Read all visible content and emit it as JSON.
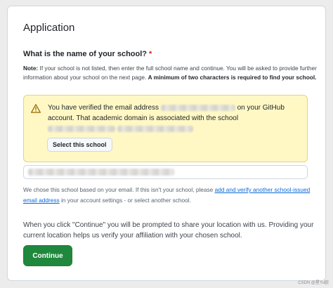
{
  "page": {
    "title": "Application"
  },
  "question": {
    "label": "What is the name of your school?",
    "required_marker": "*"
  },
  "note": {
    "prefix": "Note:",
    "text": " If your school is not listed, then enter the full school name and continue. You will be asked to provide further information about your school on the next page. ",
    "emphasis": "A minimum of two characters is required to find your school."
  },
  "verification": {
    "icon": "alert-triangle-icon",
    "part1": "You have verified the email address ",
    "part2": " on your GitHub account. That academic domain is associated with the school ",
    "select_button": "Select this school"
  },
  "hint": {
    "text_before": "We chose this school based on your email. If this isn't your school, please ",
    "link": "add and verify another school-issued email address",
    "text_after": " in your account settings - or select another school."
  },
  "continue_section": {
    "text": "When you click \"Continue\" you will be prompted to share your location with us. Providing your current location helps us verify your affiliation with your chosen school.",
    "button": "Continue"
  },
  "watermark": "CSDN @星Yu欧",
  "colors": {
    "primary_button": "#1f883d",
    "flash_background": "#fff8c5",
    "link": "#0969da",
    "required": "#cf222e"
  }
}
